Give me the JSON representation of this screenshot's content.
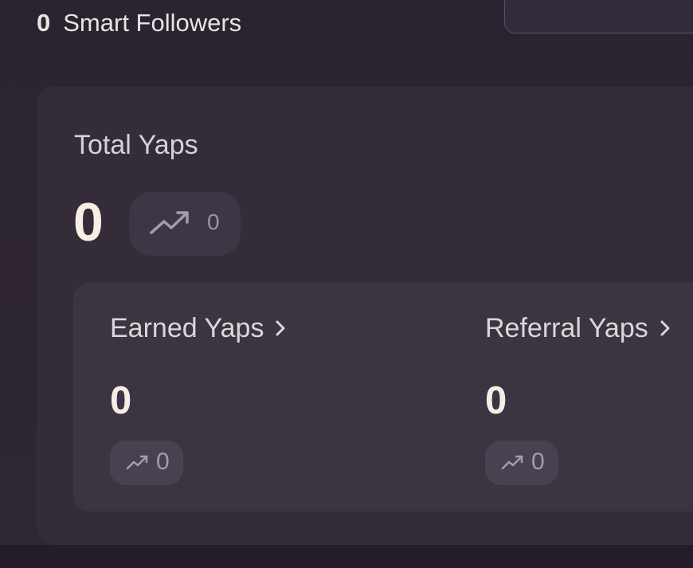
{
  "followers": {
    "count": "0",
    "label": "Smart Followers"
  },
  "total_yaps": {
    "label": "Total Yaps",
    "value": "0",
    "trend_value": "0"
  },
  "earned_yaps": {
    "label": "Earned Yaps",
    "value": "0",
    "trend_value": "0"
  },
  "referral_yaps": {
    "label": "Referral Yaps",
    "value": "0",
    "trend_value": "0"
  },
  "icons": {
    "trend": "trend-up-icon",
    "chevron": "chevron-right-icon"
  },
  "colors": {
    "background": "#2b2230",
    "card": "#352c3a",
    "subcard": "#3d3442",
    "value_text": "#f7efe6",
    "muted_text": "#9d95a0"
  }
}
